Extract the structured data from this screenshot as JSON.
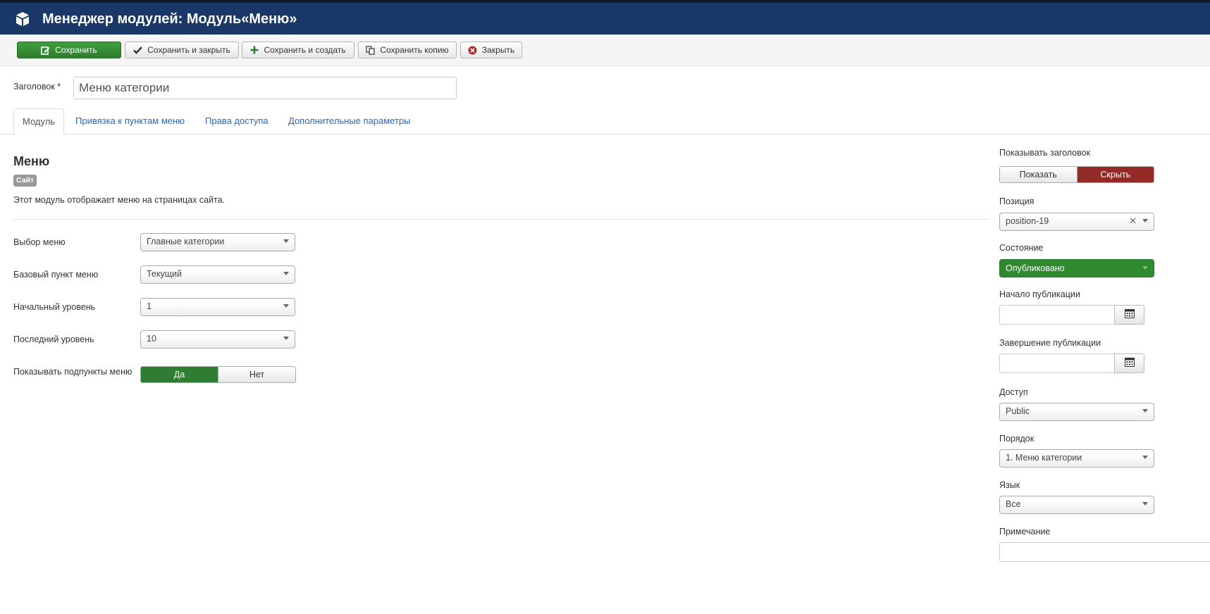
{
  "header": {
    "icon": "cube-icon",
    "title": "Менеджер модулей: Модуль«Меню»"
  },
  "toolbar": {
    "save": "Сохранить",
    "save_close": "Сохранить и закрыть",
    "save_new": "Сохранить и создать",
    "save_copy": "Сохранить копию",
    "close": "Закрыть"
  },
  "form": {
    "title_label": "Заголовок *",
    "title_value": "Меню категории"
  },
  "tabs": {
    "module": "Модуль",
    "menu_assignment": "Привязка к пунктам меню",
    "permissions": "Права доступа",
    "advanced": "Дополнительные параметры"
  },
  "module": {
    "name": "Меню",
    "badge": "Сайт",
    "description": "Этот модуль отображает меню на страницах сайта."
  },
  "fields": {
    "menu_label": "Выбор меню",
    "menu_value": "Главные категории",
    "base_label": "Базовый пункт меню",
    "base_value": "Текущий",
    "start_label": "Начальный уровень",
    "start_value": "1",
    "end_label": "Последний уровень",
    "end_value": "10",
    "sub_label": "Показывать подпункты меню",
    "sub_yes": "Да",
    "sub_no": "Нет",
    "sub_selected": "Да"
  },
  "sidebar": {
    "show_title_label": "Показывать заголовок",
    "show": "Показать",
    "hide": "Скрыть",
    "show_title_selected": "Скрыть",
    "position_label": "Позиция",
    "position_value": "position-19",
    "state_label": "Состояние",
    "state_value": "Опубликовано",
    "publish_up_label": "Начало публикации",
    "publish_down_label": "Завершение публикации",
    "access_label": "Доступ",
    "access_value": "Public",
    "ordering_label": "Порядок",
    "ordering_value": "1. Меню категории",
    "language_label": "Язык",
    "language_value": "Все",
    "note_label": "Примечание"
  },
  "colors": {
    "header_bg": "#1a3867",
    "primary_green": "#2f8a2f",
    "danger_red": "#942a25",
    "link_blue": "#2a69b8"
  }
}
